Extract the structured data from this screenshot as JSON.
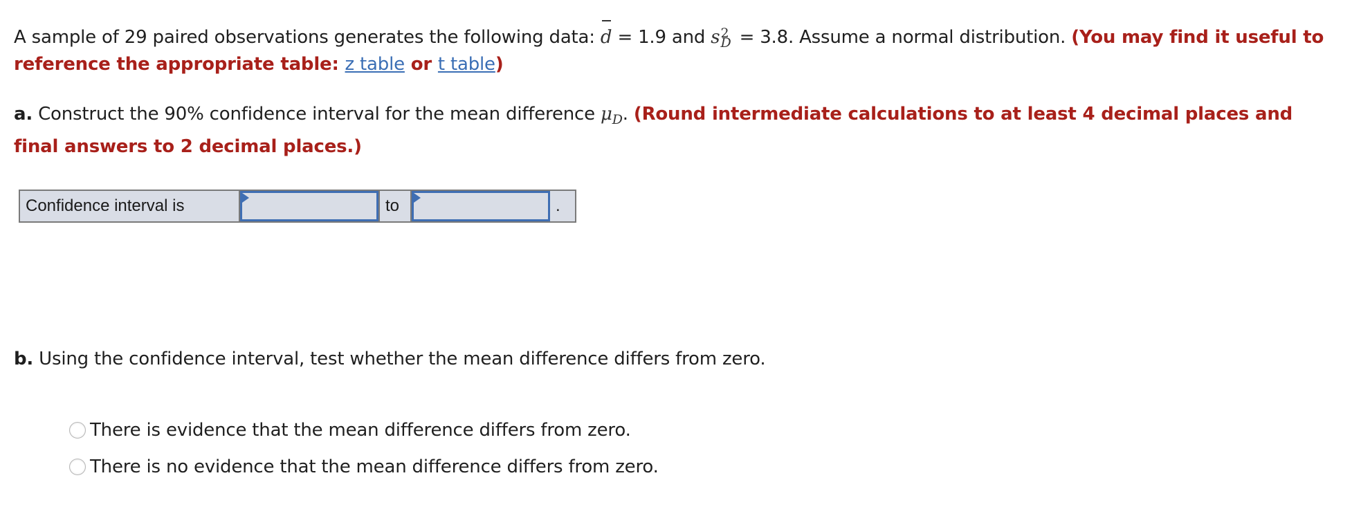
{
  "problem": {
    "intro_text": "A sample of 29 paired observations generates the following data: ",
    "dbar_symbol": "d",
    "dbar_value_text": " = 1.9 and ",
    "s_symbol": "s",
    "s_sup": "2",
    "s_sub": "D",
    "s_value_text": " = 3.8. Assume a normal distribution. ",
    "hint_prefix": "(You may find it useful to reference the appropriate table: ",
    "z_table_link": "z table",
    "or_text": " or ",
    "t_table_link": "t table",
    "hint_suffix": ")"
  },
  "part_a": {
    "label": "a.",
    "text": " Construct the 90% confidence interval for the mean difference ",
    "mu_symbol": "μ",
    "mu_sub": "D",
    "period": ". ",
    "instruction": "(Round intermediate calculations to at least 4 decimal places and final answers to 2 decimal places.)",
    "ci_row": {
      "label": "Confidence interval is",
      "lower_value": "",
      "to_text": "to",
      "upper_value": "",
      "end_text": "."
    }
  },
  "part_b": {
    "label": "b.",
    "text": " Using the confidence interval, test whether the mean difference differs from zero.",
    "options": [
      {
        "label": "There is evidence that the mean difference differs from zero.",
        "selected": false
      },
      {
        "label": "There is no evidence that the mean difference differs from zero.",
        "selected": false
      }
    ]
  },
  "colors": {
    "instruction_red": "#a8201a",
    "link_blue": "#3a6eb5",
    "input_border_blue": "#3f6eb3",
    "table_fill": "#d9dde6"
  }
}
